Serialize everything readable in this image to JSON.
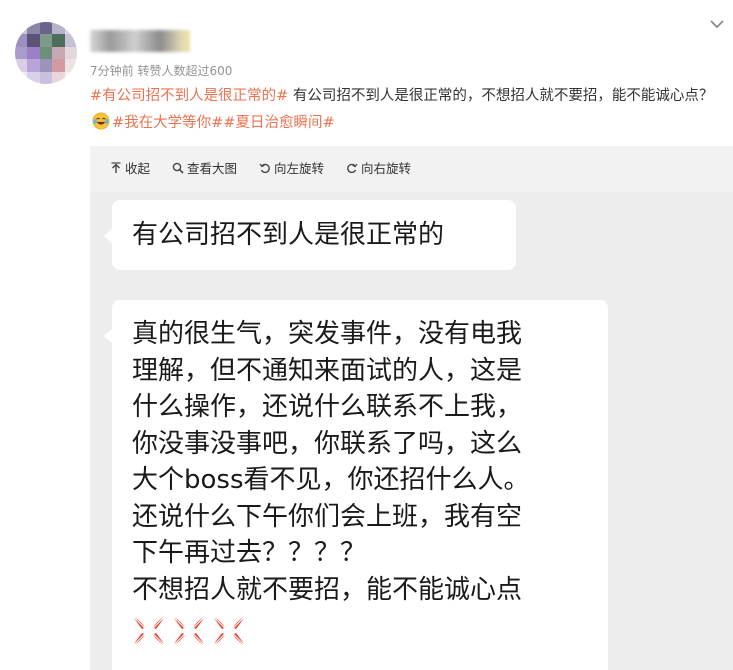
{
  "post": {
    "meta": "7分钟前 转赞人数超过600",
    "tag_1": "#有公司招不到人是很正常的#",
    "body_1": " 有公司招不到人是很正常的，不想招人就不要招，能不能诚心点？",
    "tag_2": "#我在大学等你#",
    "tag_3": "#夏日治愈瞬间#",
    "emoji_icon": "laughing-tears-emoji-icon"
  },
  "toolbar": {
    "collapse": "收起",
    "view_large": "查看大图",
    "rotate_left": "向左旋转",
    "rotate_right": "向右旋转"
  },
  "chat": {
    "bubble_1": "有公司招不到人是很正常的",
    "bubble_2_lines": [
      "真的很生气，突发事件，没有电我",
      "理解，但不通知来面试的人，这是",
      "什么操作，还说什么联系不上我，",
      "你没事没事吧，你联系了吗，这么",
      "大个boss看不见，你还招什么人。",
      "还说什么下午你们会上班，我有空",
      "下午再过去？？？？",
      "不想招人就不要招，能不能诚心点"
    ],
    "anger_icons": [
      "anger-icon",
      "anger-icon",
      "anger-icon"
    ]
  },
  "colors": {
    "tag": "#eb7350",
    "meta": "#939393",
    "panel": "#f2f2f2",
    "anger": "#e8432e"
  }
}
